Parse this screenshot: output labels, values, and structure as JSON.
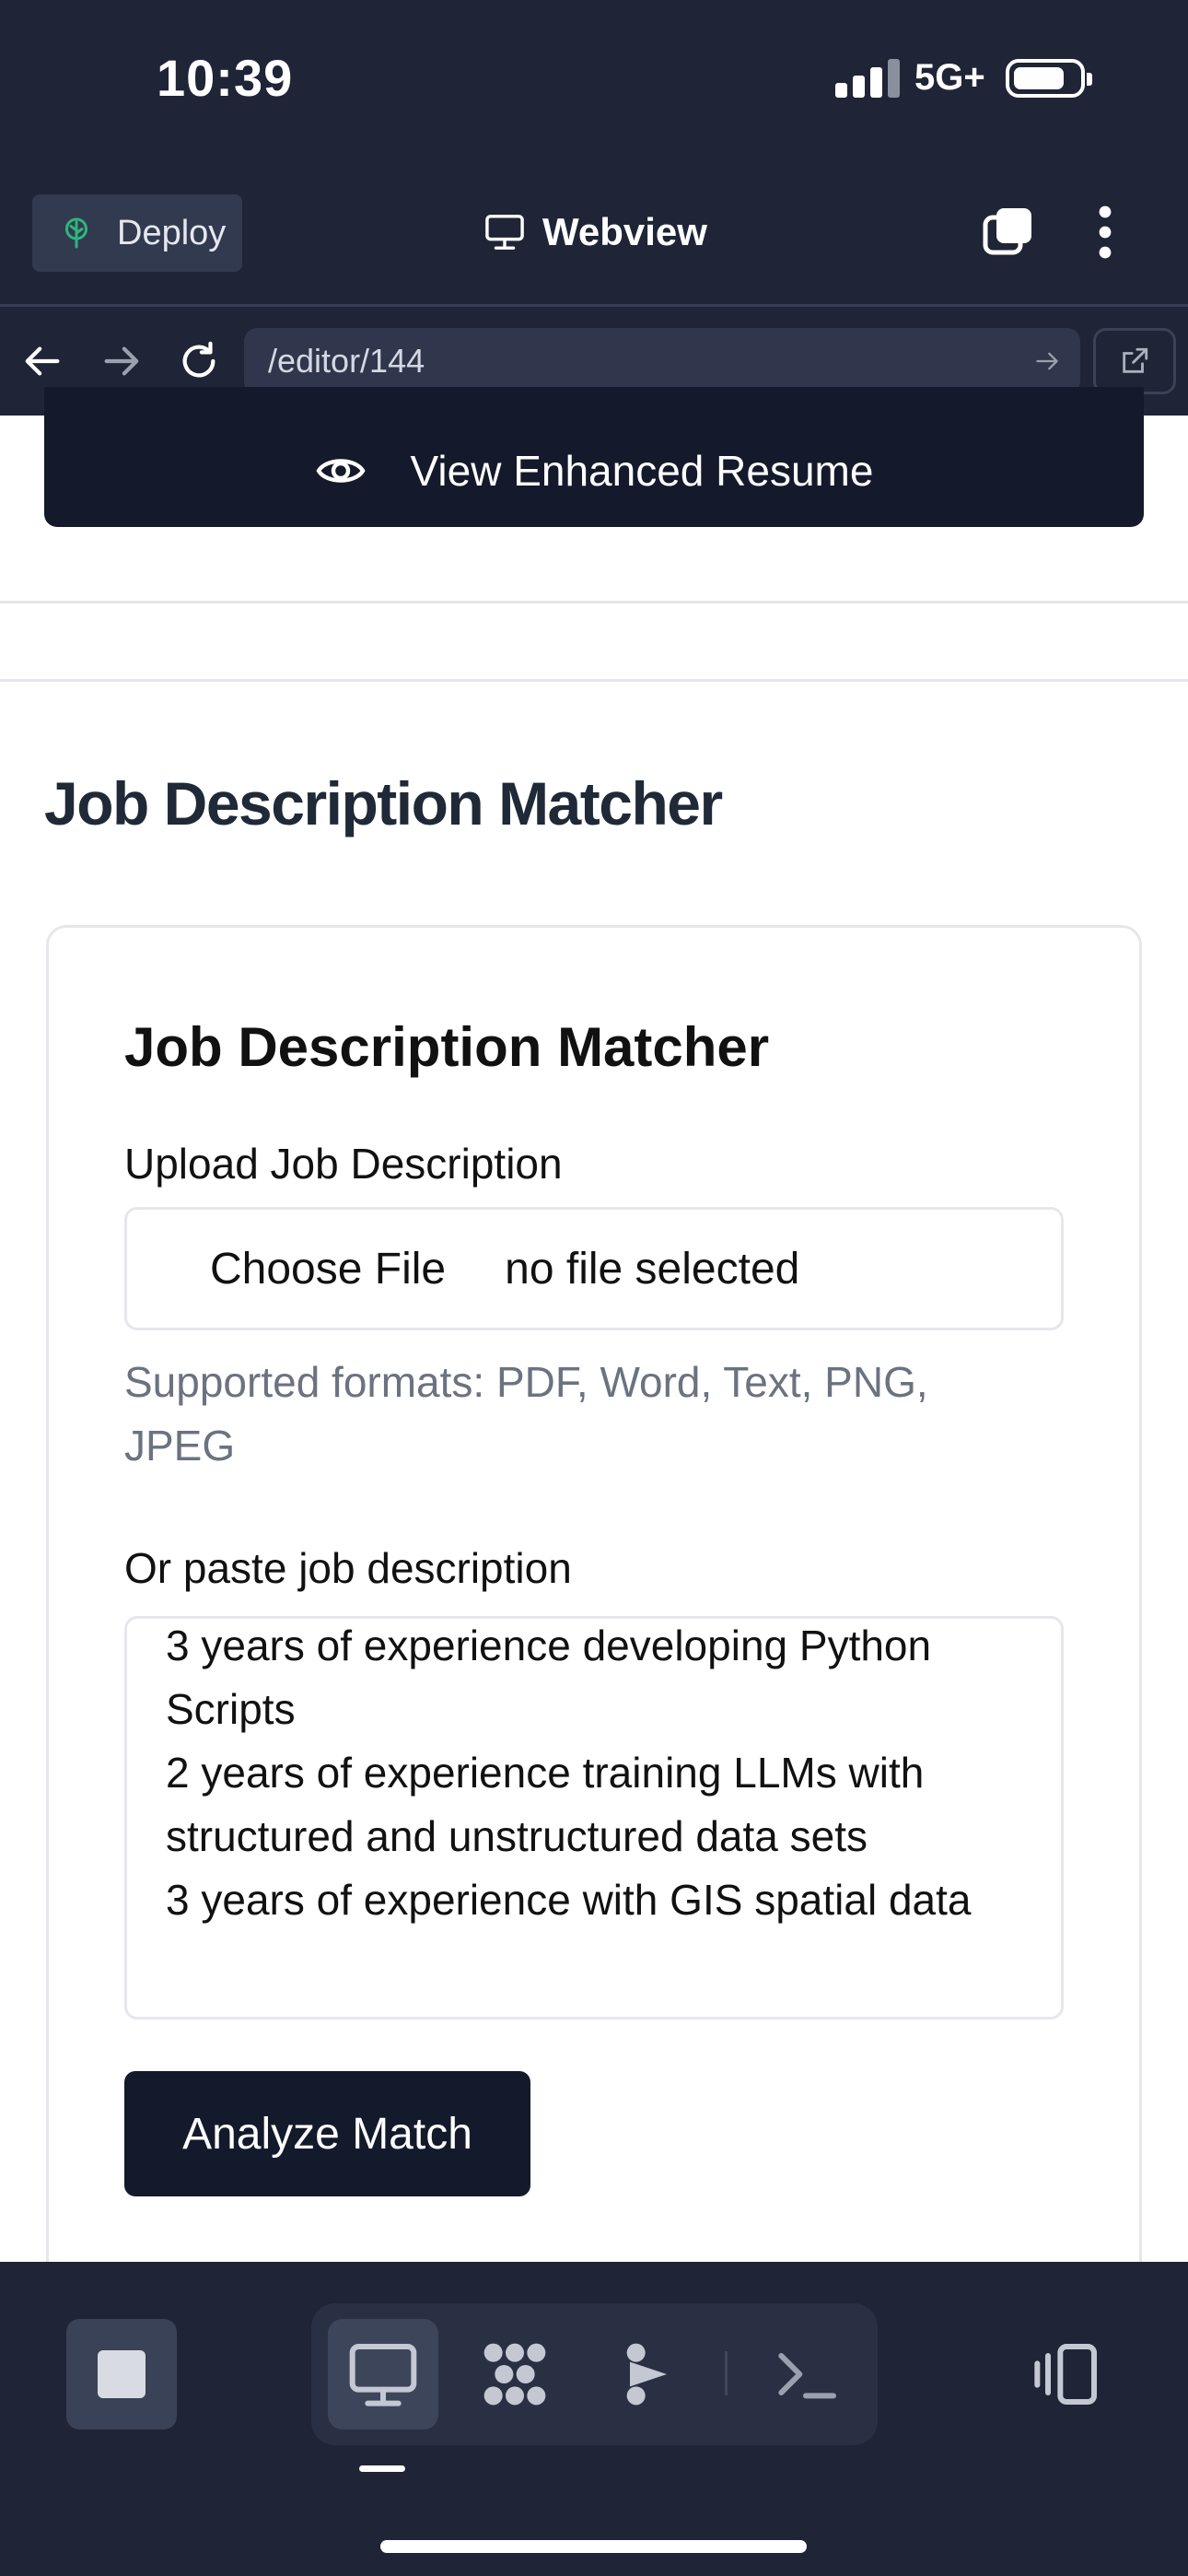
{
  "status_bar": {
    "time": "10:39",
    "network": "5G+"
  },
  "browser": {
    "deploy_label": "Deploy",
    "title": "Webview",
    "url": "/editor/144"
  },
  "page": {
    "view_button_label": "View Enhanced Resume",
    "section_title": "Job Description Matcher",
    "card": {
      "title": "Job Description Matcher",
      "upload_label": "Upload Job Description",
      "choose_file_label": "Choose File",
      "file_status": "no file selected",
      "help_text": "Supported formats: PDF, Word, Text, PNG, JPEG",
      "paste_label": "Or paste job description",
      "textarea_value": "3 years of experience developing Python Scripts\n2 years of experience training LLMs with structured and unstructured data sets\n3 years of experience with GIS spatial data",
      "analyze_label": "Analyze Match"
    }
  },
  "toolbar": {
    "items": [
      "stop-icon",
      "desktop-icon",
      "apps-grid-icon",
      "ai-agent-icon",
      "terminal-icon",
      "device-toggle-icon"
    ],
    "active": "desktop-icon"
  },
  "colors": {
    "chrome_bg": "#1f2436",
    "primary_button": "#131a2b",
    "heading": "#1f2937",
    "muted_text": "#6b7280",
    "border": "#e5e7eb"
  }
}
